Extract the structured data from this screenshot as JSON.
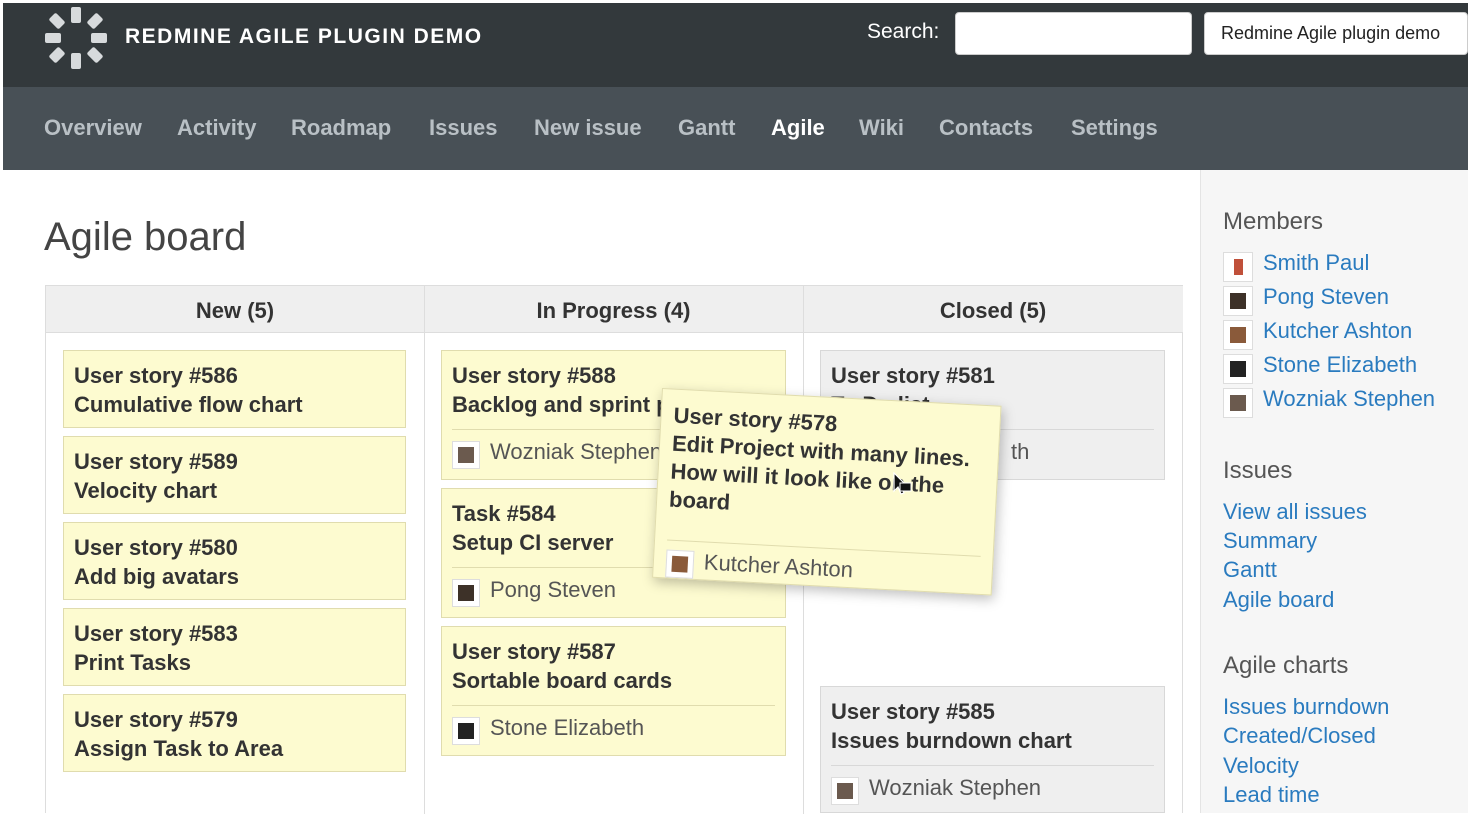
{
  "header": {
    "title": "REDMINE AGILE PLUGIN DEMO",
    "search_label": "Search:",
    "search_value": "",
    "project": "Redmine Agile plugin demo"
  },
  "nav": {
    "items": [
      "Overview",
      "Activity",
      "Roadmap",
      "Issues",
      "New issue",
      "Gantt",
      "Agile",
      "Wiki",
      "Contacts",
      "Settings"
    ],
    "active": "Agile"
  },
  "main": {
    "title": "Agile board",
    "columns": [
      {
        "label": "New (5)"
      },
      {
        "label": "In Progress (4)"
      },
      {
        "label": "Closed (5)"
      }
    ],
    "new_cards": [
      {
        "title": "User story #586",
        "subject": "Cumulative flow chart"
      },
      {
        "title": "User story #589",
        "subject": "Velocity chart"
      },
      {
        "title": "User story #580",
        "subject": "Add big avatars"
      },
      {
        "title": "User story #583",
        "subject": "Print Tasks"
      },
      {
        "title": "User story #579",
        "subject": "Assign Task to Area"
      }
    ],
    "progress_cards": [
      {
        "title": "User story #588",
        "subject": "Backlog and sprint p",
        "assignee": "Wozniak Stephen"
      },
      {
        "title": "Task #584",
        "subject": "Setup CI server",
        "assignee": "Pong Steven"
      },
      {
        "title": "User story #587",
        "subject": "Sortable board cards",
        "assignee": "Stone Elizabeth"
      }
    ],
    "closed_cards": [
      {
        "title": "User story #581",
        "subject": "To Do list",
        "assignee_fragment": "th"
      },
      {
        "title": "User story #585",
        "subject": "Issues burndown chart",
        "assignee": "Wozniak Stephen"
      }
    ],
    "dragged_card": {
      "title": "User story #578",
      "line1": "Edit Project with many lines.",
      "line2": "How will it look like on the",
      "line3": "board",
      "assignee": "Kutcher Ashton"
    }
  },
  "sidebar": {
    "members_heading": "Members",
    "members": [
      "Smith Paul",
      "Pong Steven",
      "Kutcher Ashton",
      "Stone Elizabeth",
      "Wozniak Stephen"
    ],
    "issues_heading": "Issues",
    "issues_links": [
      "View all issues",
      "Summary",
      "Gantt",
      "Agile board"
    ],
    "charts_heading": "Agile charts",
    "charts_links": [
      "Issues burndown",
      "Created/Closed",
      "Velocity",
      "Lead time"
    ]
  }
}
